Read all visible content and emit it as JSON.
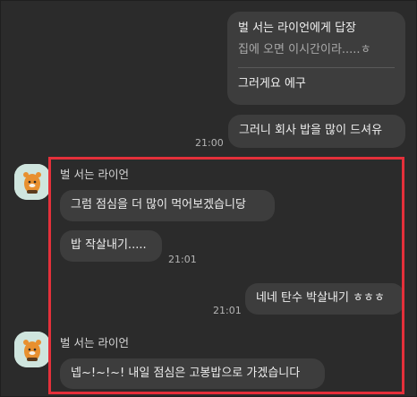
{
  "messages": {
    "reply": {
      "header": "벌 서는 라이언에게 답장",
      "quoted": "집에 오면 이시간이라.....ㅎ",
      "text": "그러게요 에구"
    },
    "out1": {
      "text": "그러니 회사 밥을 많이 드셔유",
      "time": "21:00"
    },
    "group1": {
      "sender": "벌 서는 라이언",
      "msg1": "그럼 점심을 더 많이 먹어보겠습니당",
      "msg2": "밥 작살내기.....",
      "time": "21:01"
    },
    "out2": {
      "text": "네네 탄수 박살내기 ㅎㅎㅎ",
      "time": "21:01"
    },
    "group2": {
      "sender": "벌 서는 라이언",
      "msg1": "넵~!~!~! 내일 점심은 고봉밥으로 가겠습니다"
    }
  },
  "colors": {
    "background": "#2b2b2b",
    "bubble": "#3d3d3d",
    "highlight": "#e4303a",
    "avatar_bg": "#cfe5de"
  },
  "icons": {
    "avatar": "ryan-character-icon"
  }
}
